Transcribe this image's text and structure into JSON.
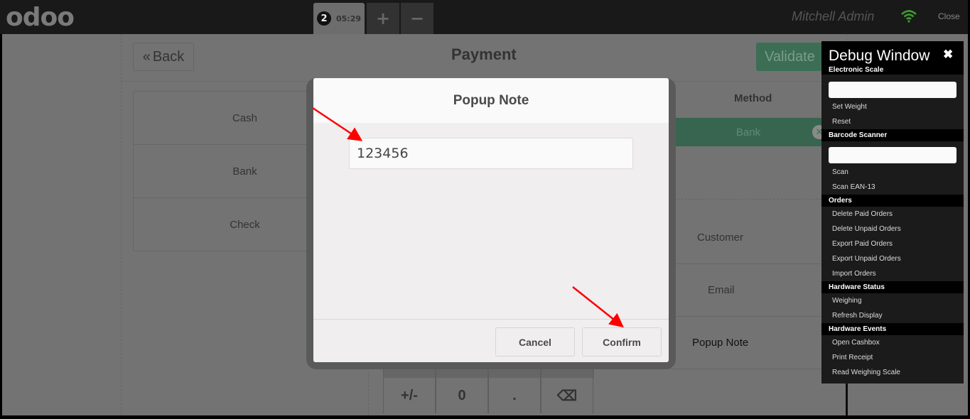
{
  "topbar": {
    "logo": "odoo",
    "order_number": "2",
    "order_time": "05:29",
    "add_order": "+",
    "remove_order": "−",
    "user_name": "Mitchell Admin",
    "close_label": "Close",
    "wifi_color": "#3c9a2e"
  },
  "payment": {
    "back_label": "Back",
    "back_icon": "«",
    "title": "Payment",
    "validate_label": "Validate",
    "methods": [
      "Cash",
      "Bank",
      "Check"
    ],
    "lines_header": "Method",
    "lines": [
      {
        "method": "Bank"
      }
    ],
    "side_buttons": [
      "Customer",
      "Email",
      "Popup Note"
    ],
    "numpad_bottom_row": [
      "+/-",
      "0",
      ".",
      "⌫"
    ]
  },
  "popup": {
    "title": "Popup Note",
    "input_value": "123456",
    "cancel_label": "Cancel",
    "confirm_label": "Confirm"
  },
  "debug": {
    "title": "Debug Window",
    "close_icon": "✖",
    "sections": {
      "electronic_scale": "Electronic Scale",
      "set_weight": "Set Weight",
      "reset": "Reset",
      "barcode_scanner": "Barcode Scanner",
      "scan": "Scan",
      "scan_ean13": "Scan EAN-13",
      "orders": "Orders",
      "delete_paid": "Delete Paid Orders",
      "delete_unpaid": "Delete Unpaid Orders",
      "export_paid": "Export Paid Orders",
      "export_unpaid": "Export Unpaid Orders",
      "import_orders": "Import Orders",
      "hardware_status": "Hardware Status",
      "weighing": "Weighing",
      "refresh_display": "Refresh Display",
      "hardware_events": "Hardware Events",
      "open_cashbox": "Open Cashbox",
      "print_receipt": "Print Receipt",
      "read_weighing_scale": "Read Weighing Scale"
    }
  },
  "annotations": {
    "arrow_color": "#ff0000"
  }
}
